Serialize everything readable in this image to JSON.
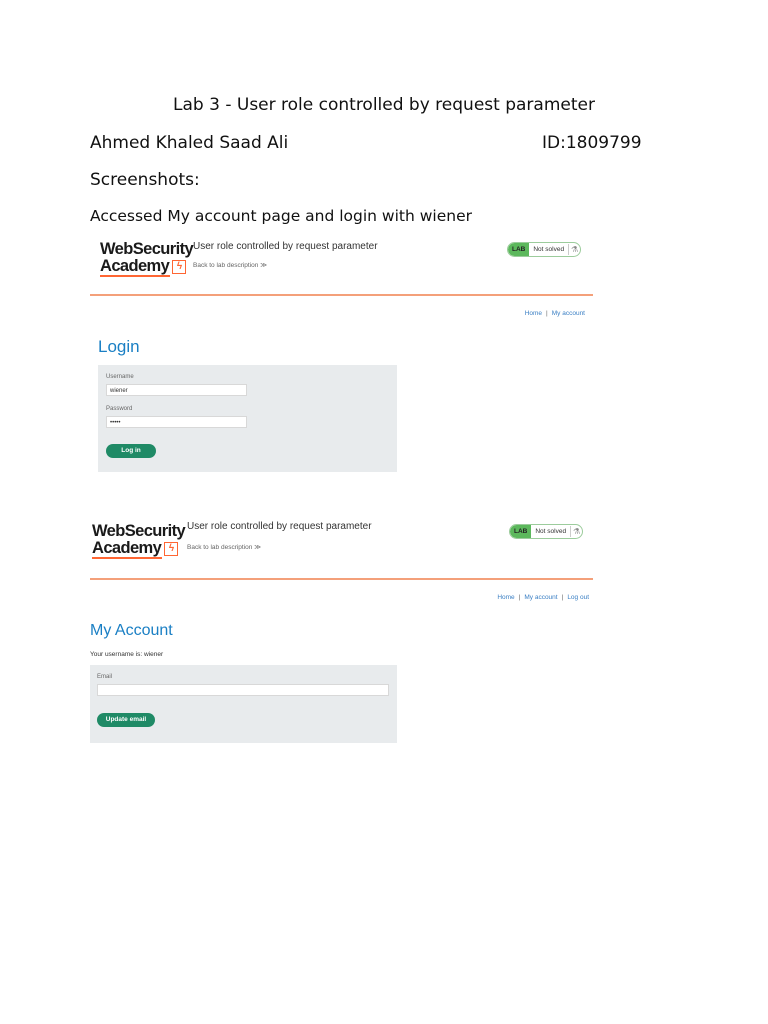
{
  "document": {
    "title": "Lab 3 - User role controlled by request parameter",
    "author": "Ahmed Khaled Saad Ali",
    "student_id": "ID:1809799",
    "screenshots_heading": "Screenshots:",
    "caption": "Accessed My account page and login with wiener"
  },
  "screenshot1": {
    "logo_line1": "WebSecurity",
    "logo_line2": "Academy",
    "lab_title": "User role controlled by request parameter",
    "back_link": "Back to lab description  ≫",
    "status_badge": "LAB",
    "status_text": "Not solved",
    "nav_home": "Home",
    "nav_separator": "|",
    "nav_my_account": "My account",
    "heading": "Login",
    "username_label": "Username",
    "username_value": "wiener",
    "password_label": "Password",
    "password_value": "•••••",
    "login_button": "Log in"
  },
  "screenshot2": {
    "logo_line1": "WebSecurity",
    "logo_line2": "Academy",
    "lab_title": "User role controlled by request parameter",
    "back_link": "Back to lab description  ≫",
    "status_badge": "LAB",
    "status_text": "Not solved",
    "nav_home": "Home",
    "nav_separator": "|",
    "nav_my_account": "My account",
    "nav_log_out": "Log out",
    "heading": "My Account",
    "username_text": "Your username is: wiener",
    "email_label": "Email",
    "email_value": "",
    "update_button": "Update email"
  },
  "colors": {
    "accent_orange": "#ff6633",
    "link_blue": "#1a7fc4",
    "button_green": "#1f8a66",
    "panel_grey": "#e8ebed"
  },
  "icons": [
    "logo-bolt-icon",
    "flask-icon"
  ]
}
